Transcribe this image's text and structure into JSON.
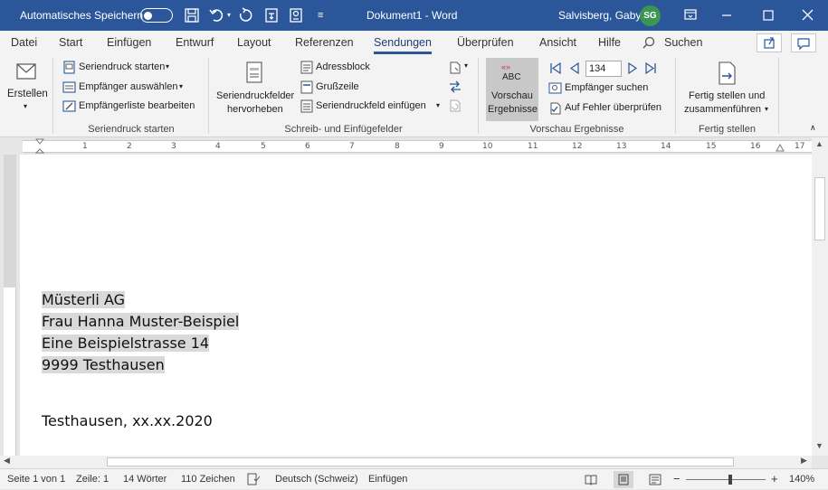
{
  "titlebar": {
    "autosave_label": "Automatisches Speichern",
    "qat_more": "≡",
    "doc_title": "Dokument1  -  Word",
    "user_name": "Salvisberg, Gaby",
    "user_initials": "SG"
  },
  "tabs": [
    {
      "label": "Datei"
    },
    {
      "label": "Start"
    },
    {
      "label": "Einfügen"
    },
    {
      "label": "Entwurf"
    },
    {
      "label": "Layout"
    },
    {
      "label": "Referenzen"
    },
    {
      "label": "Sendungen"
    },
    {
      "label": "Überprüfen"
    },
    {
      "label": "Ansicht"
    },
    {
      "label": "Hilfe"
    }
  ],
  "tell_me": "Suchen",
  "ribbon": {
    "erstellen": "Erstellen",
    "serienstart": {
      "start": "Seriendruck starten",
      "empfaenger": "Empfänger auswählen",
      "liste": "Empfängerliste bearbeiten",
      "group": "Seriendruck starten"
    },
    "felder": {
      "hervorheben_1": "Seriendruckfelder",
      "hervorheben_2": "hervorheben",
      "adressblock": "Adressblock",
      "gruss": "Grußzeile",
      "feld": "Seriendruckfeld einfügen",
      "group": "Schreib- und Einfügefelder"
    },
    "vorschau": {
      "abc": "ABC",
      "v1": "Vorschau",
      "v2": "Ergebnisse",
      "record": "134",
      "suchen": "Empfänger suchen",
      "fehler": "Auf Fehler überprüfen",
      "group": "Vorschau Ergebnisse"
    },
    "fertig": {
      "f1": "Fertig stellen und",
      "f2": "zusammenführen",
      "group": "Fertig stellen"
    }
  },
  "ruler": {
    "tab_selector": "L",
    "numbers": [
      "1",
      "2",
      "3",
      "4",
      "5",
      "6",
      "7",
      "8",
      "9",
      "10",
      "11",
      "12",
      "13",
      "14",
      "15",
      "16",
      "17"
    ]
  },
  "document": {
    "address": [
      "Müsterli AG",
      "Frau Hanna Muster-Beispiel",
      "Eine Beispielstrasse 14",
      "9999 Testhausen"
    ],
    "place_date": "Testhausen, xx.xx.2020"
  },
  "status": {
    "page": "Seite 1 von 1",
    "line": "Zeile: 1",
    "words": "14 Wörter",
    "chars": "110 Zeichen",
    "language": "Deutsch (Schweiz)",
    "mode": "Einfügen",
    "zoom": "140%"
  }
}
